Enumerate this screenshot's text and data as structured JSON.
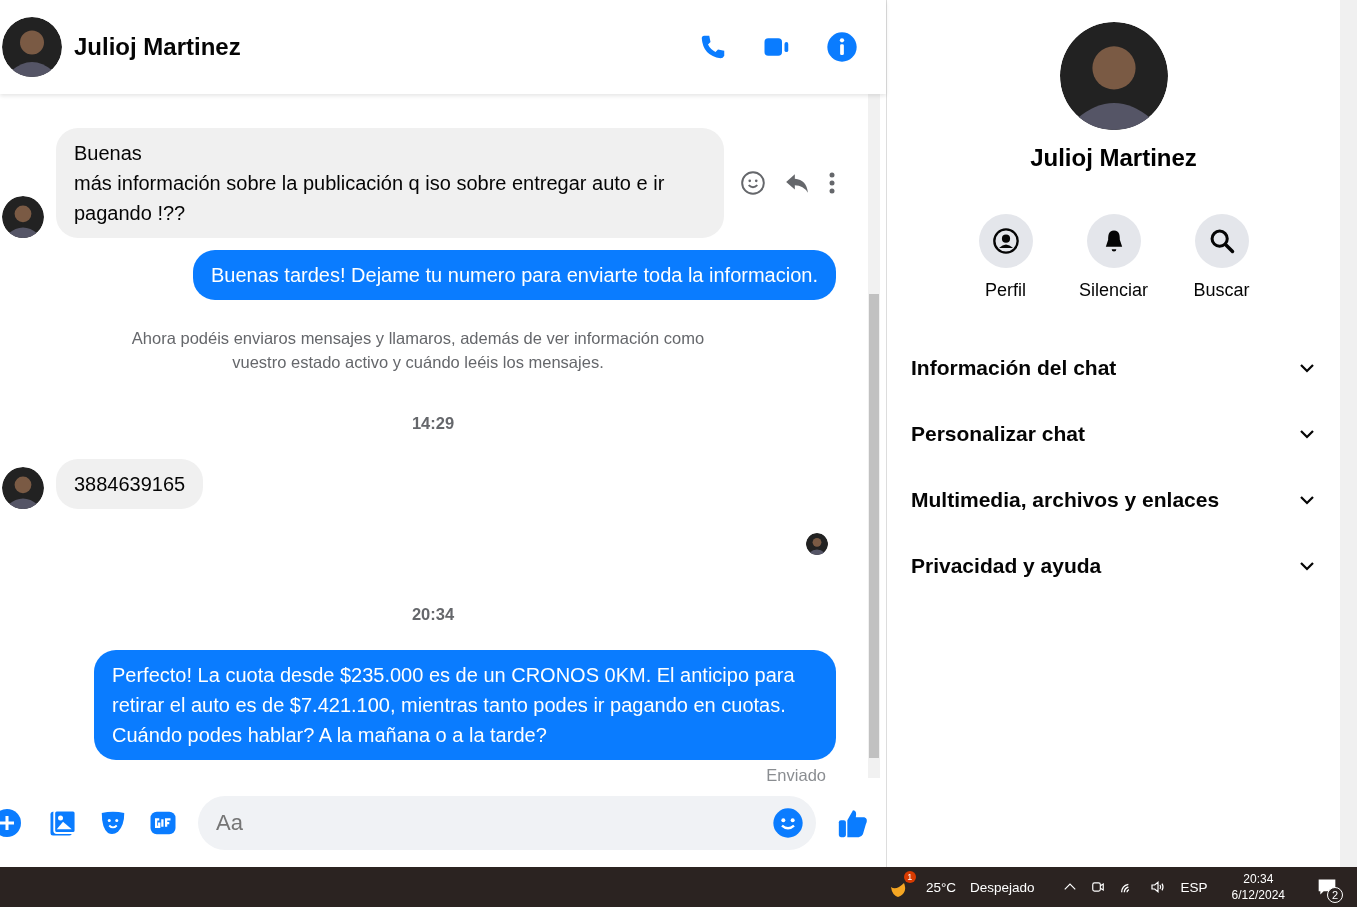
{
  "chat": {
    "contact": "Julioj Martinez",
    "messages": [
      {
        "kind": "incoming",
        "text": "Buenas\nmás información sobre la publicación q iso sobre entregar auto e ir pagando !??",
        "actions": true
      },
      {
        "kind": "outgoing",
        "text": "Buenas tardes! Dejame tu numero para enviarte toda la informacion."
      },
      {
        "kind": "notice",
        "text": "Ahora podéis enviaros mensajes y llamaros, además de ver información como vuestro estado activo y cuándo leéis los mensajes."
      },
      {
        "kind": "time",
        "text": "14:29"
      },
      {
        "kind": "incoming",
        "text": "3884639165",
        "actions": false
      },
      {
        "kind": "seen"
      },
      {
        "kind": "time",
        "text": "20:34"
      },
      {
        "kind": "outgoing",
        "text": "Perfecto! La cuota desde $235.000 es de un CRONOS 0KM. El anticipo para retirar el auto es de $7.421.100, mientras tanto podes ir pagando en cuotas. Cuándo podes hablar? A la mañana o a la tarde?"
      },
      {
        "kind": "status",
        "text": "Enviado"
      }
    ],
    "composer": {
      "placeholder": "Aa"
    }
  },
  "profile": {
    "name": "Julioj Martinez",
    "actions": [
      {
        "kind": "profile",
        "label": "Perfil"
      },
      {
        "kind": "mute",
        "label": "Silenciar"
      },
      {
        "kind": "search",
        "label": "Buscar"
      }
    ],
    "sections": [
      {
        "label": "Información del chat",
        "expanded": false
      },
      {
        "label": "Personalizar chat",
        "expanded": false
      },
      {
        "label": "Multimedia, archivos y enlaces",
        "expanded": false
      },
      {
        "label": "Privacidad y ayuda",
        "expanded": false
      }
    ]
  },
  "taskbar": {
    "weather_badge": "1",
    "temperature": "25°C",
    "weather": "Despejado",
    "language": "ESP",
    "time": "20:34",
    "date": "6/12/2024",
    "notifications": "2"
  }
}
